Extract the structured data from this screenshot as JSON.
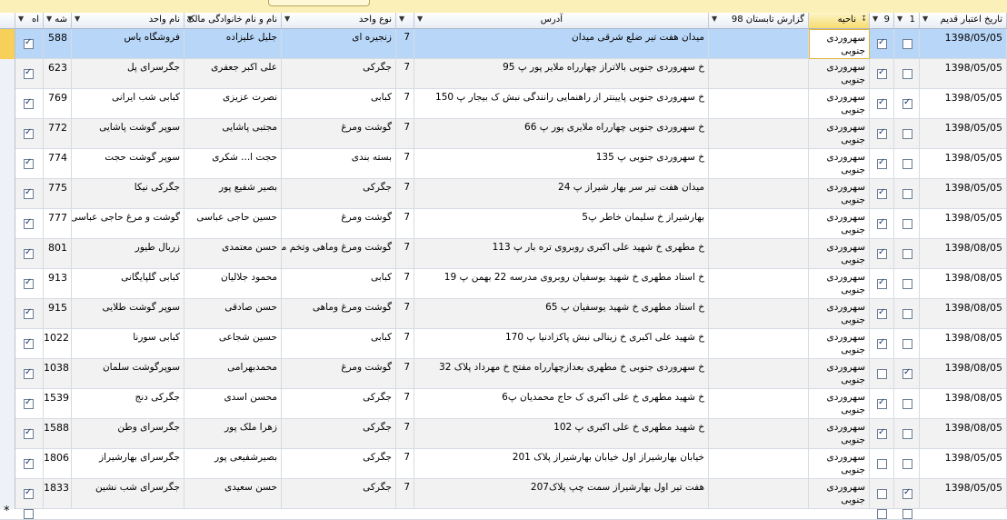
{
  "headers": {
    "col1": "اه",
    "col2": "شه",
    "col3": "نام واحد",
    "col4": "نام و نام خانوادگی مالک",
    "col5": "نوع واحد",
    "col6": "",
    "col7": "آدرس",
    "col8": "گزارش تابستان 98",
    "col9": "ناحیه",
    "col10": "9",
    "col11": "1",
    "col12": "تاریخ اعتبار قدیم"
  },
  "rows": [
    {
      "chk1": true,
      "num": "588",
      "unit": "فروشگاه یاس",
      "owner": "جلیل علیزاده",
      "type": "زنجیره ای",
      "code": "7",
      "address": "میدان هفت تیر ضلع شرقی میدان",
      "district": "سهروردی جنوبی",
      "c9": true,
      "c1": false,
      "date": "1398/05/05"
    },
    {
      "chk1": true,
      "num": "623",
      "unit": "جگرسرای پل",
      "owner": "علی اکبر جعفری",
      "type": "جگرکی",
      "code": "7",
      "address": "خ سهروردی جنوبی  بالاتراز چهارراه ملایر پور پ 95",
      "district": "سهروردی جنوبی",
      "c9": true,
      "c1": false,
      "date": "1398/05/05"
    },
    {
      "chk1": true,
      "num": "769",
      "unit": "کبابی شب ایرانی",
      "owner": "نصرت عزیزی",
      "type": "کبابی",
      "code": "7",
      "address": "خ سهروردی جنوبی پایینتر از راهنمایی رانندگی نبش ک بیجار پ 150",
      "district": "سهروردی جنوبی",
      "c9": true,
      "c1": true,
      "date": "1398/05/05"
    },
    {
      "chk1": true,
      "num": "772",
      "unit": "سوپر گوشت پاشایی",
      "owner": "مجتبی پاشایی",
      "type": "گوشت ومرغ",
      "code": "7",
      "address": "خ سهروردی جنوبی چهارراه ملایری پور پ 66",
      "district": "سهروردی جنوبی",
      "c9": true,
      "c1": false,
      "date": "1398/05/05"
    },
    {
      "chk1": true,
      "num": "774",
      "unit": "سوپر گوشت حجت",
      "owner": "حجت ا... شکری",
      "type": "بسته بندی",
      "code": "7",
      "address": "خ سهروردی جنوبی پ 135",
      "district": "سهروردی جنوبی",
      "c9": true,
      "c1": false,
      "date": "1398/05/05"
    },
    {
      "chk1": true,
      "num": "775",
      "unit": "جگرکی نیکا",
      "owner": "بصیر شفیع پور",
      "type": "جگرکی",
      "code": "7",
      "address": "میدان هفت تیر سر بهار شیراز پ 24",
      "district": "سهروردی جنوبی",
      "c9": true,
      "c1": false,
      "date": "1398/05/05"
    },
    {
      "chk1": true,
      "num": "777",
      "unit": "گوشت و مرغ حاجی عباسی",
      "owner": "حسین حاجی عباسی",
      "type": "گوشت ومرغ",
      "code": "7",
      "address": "بهارشیراز خ سلیمان خاطر پ5",
      "district": "سهروردی جنوبی",
      "c9": true,
      "c1": false,
      "date": "1398/05/05"
    },
    {
      "chk1": true,
      "num": "801",
      "unit": "زربال طیور",
      "owner": "حسن معتمدی",
      "type": "گوشت ومرغ وماهی وتخم مرغ",
      "code": "7",
      "address": "خ مطهری خ شهید علی اکبری روبروی تره بار پ 113",
      "district": "سهروردی جنوبی",
      "c9": true,
      "c1": false,
      "date": "1398/08/05"
    },
    {
      "chk1": true,
      "num": "913",
      "unit": "کبابی گلپایگانی",
      "owner": "محمود جلالیان",
      "type": "کبابی",
      "code": "7",
      "address": "خ استاد مطهری خ شهید یوسفیان روبروی مدرسه 22 بهمن پ 19",
      "district": "سهروردی جنوبی",
      "c9": true,
      "c1": false,
      "date": "1398/08/05"
    },
    {
      "chk1": true,
      "num": "915",
      "unit": "سوپر گوشت طلایی",
      "owner": "حسن صادقی",
      "type": "گوشت ومرغ وماهی",
      "code": "7",
      "address": "خ استاد مطهری خ شهید یوسفیان پ 65",
      "district": "سهروردی جنوبی",
      "c9": true,
      "c1": false,
      "date": "1398/08/05"
    },
    {
      "chk1": true,
      "num": "1022",
      "unit": "کبابی سورنا",
      "owner": "حسین شجاعی",
      "type": "کبابی",
      "code": "7",
      "address": "خ شهید علی اکبری خ زینالی نبش پاکزادنیا پ 170",
      "district": "سهروردی جنوبی",
      "c9": true,
      "c1": false,
      "date": "1398/08/05"
    },
    {
      "chk1": true,
      "num": "1038",
      "unit": "سوپرگوشت سلمان",
      "owner": "محمدبهرامی",
      "type": "گوشت ومرغ",
      "code": "7",
      "address": "خ سهروردی جنوبی خ مطهری بعدازچهارراه مفتح خ مهرداد پلاک 32",
      "district": "سهروردی جنوبی",
      "c9": false,
      "c1": true,
      "date": "1398/08/05"
    },
    {
      "chk1": true,
      "num": "1539",
      "unit": "جگرکی دنج",
      "owner": "محسن اسدی",
      "type": "جگرکی",
      "code": "7",
      "address": "خ شهید مطهری خ علی اکبری ک حاج محمدیان پ6",
      "district": "سهروردی جنوبی",
      "c9": true,
      "c1": false,
      "date": "1398/08/05"
    },
    {
      "chk1": true,
      "num": "1588",
      "unit": "جگرسرای وطن",
      "owner": "زهرا ملک پور",
      "type": "جگرکی",
      "code": "7",
      "address": "خ شهید مطهری خ علی اکبری پ 102",
      "district": "سهروردی جنوبی",
      "c9": true,
      "c1": false,
      "date": "1398/08/05"
    },
    {
      "chk1": true,
      "num": "1806",
      "unit": "جگرسرای بهارشیراز",
      "owner": "بصیرشفیعی پور",
      "type": "جگرکی",
      "code": "7",
      "address": "خیابان بهارشیراز اول خیابان بهارشیراز پلاک 201",
      "district": "سهروردی جنوبی",
      "c9": false,
      "c1": false,
      "date": "1398/05/05"
    },
    {
      "chk1": true,
      "num": "1833",
      "unit": "جگرسرای شب نشین",
      "owner": "حسن سعیدی",
      "type": "جگرکی",
      "code": "7",
      "address": "هفت تیر اول بهارشیراز سمت چپ پلاک207",
      "district": "سهروردی جنوبی",
      "c9": false,
      "c1": true,
      "date": "1398/05/05"
    }
  ],
  "new_row_marker": "*"
}
